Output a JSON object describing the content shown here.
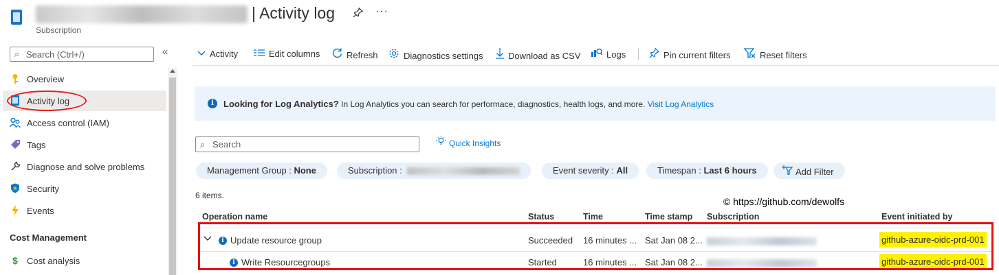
{
  "header": {
    "title": "| Activity log",
    "subtitle": "Subscription",
    "pin_icon": "pin-icon",
    "more_label": "···"
  },
  "sidebar": {
    "search_placeholder": "Search (Ctrl+/)",
    "collapse_label": "«",
    "items": [
      {
        "label": "Overview",
        "icon": "key-icon",
        "color": "#f2b900"
      },
      {
        "label": "Activity log",
        "icon": "activity-log-icon",
        "color": "#0078d4",
        "selected": true
      },
      {
        "label": "Access control (IAM)",
        "icon": "people-icon",
        "color": "#0078d4"
      },
      {
        "label": "Tags",
        "icon": "tag-icon",
        "color": "#8661c5"
      },
      {
        "label": "Diagnose and solve problems",
        "icon": "wrench-icon",
        "color": "#323130"
      },
      {
        "label": "Security",
        "icon": "shield-icon",
        "color": "#0078d4"
      },
      {
        "label": "Events",
        "icon": "lightning-icon",
        "color": "#f2b900"
      }
    ],
    "section_title": "Cost Management",
    "section_items": [
      {
        "label": "Cost analysis",
        "icon": "cost-icon",
        "color": "#3b8f3b"
      }
    ]
  },
  "toolbar": {
    "items": [
      {
        "label": "Activity",
        "icon": "chevron-down-icon"
      },
      {
        "label": "Edit columns",
        "icon": "columns-icon"
      },
      {
        "label": "Refresh",
        "icon": "refresh-icon"
      },
      {
        "label": "Diagnostics settings",
        "icon": "gear-icon"
      },
      {
        "label": "Download as CSV",
        "icon": "download-icon"
      },
      {
        "label": "Logs",
        "icon": "logs-icon"
      },
      {
        "label": "Pin current filters",
        "icon": "pin-icon"
      },
      {
        "label": "Reset filters",
        "icon": "filter-reset-icon"
      }
    ]
  },
  "banner": {
    "bold": "Looking for Log Analytics?",
    "text": " In Log Analytics you can search for performace, diagnostics, health logs, and more. ",
    "link": "Visit Log Analytics"
  },
  "search": {
    "placeholder": "Search",
    "quick_insights": "Quick Insights"
  },
  "filters": {
    "mgmt_label": "Management Group : ",
    "mgmt_value": "None",
    "subscription_label": "Subscription : ",
    "severity_label": "Event severity : ",
    "severity_value": "All",
    "timespan_label": "Timespan : ",
    "timespan_value": "Last 6 hours",
    "add_filter": "Add Filter"
  },
  "items_count": "6 items.",
  "watermark": "© https://github.com/dewolfs",
  "table": {
    "headers": {
      "operation": "Operation name",
      "status": "Status",
      "time": "Time",
      "timestamp": "Time stamp",
      "subscription": "Subscription",
      "initiated": "Event initiated by"
    },
    "rows": [
      {
        "operation": "Update resource group",
        "status": "Succeeded",
        "time": "16 minutes ...",
        "timestamp": "Sat Jan 08 2...",
        "initiated": "github-azure-oidc-prd-001"
      },
      {
        "operation": "Write Resourcegroups",
        "status": "Started",
        "time": "16 minutes ...",
        "timestamp": "Sat Jan 08 2...",
        "initiated": "github-azure-oidc-prd-001"
      }
    ]
  },
  "colors": {
    "accent": "#0078d4",
    "highlight": "#fff200",
    "annotation_red": "#e81010"
  }
}
